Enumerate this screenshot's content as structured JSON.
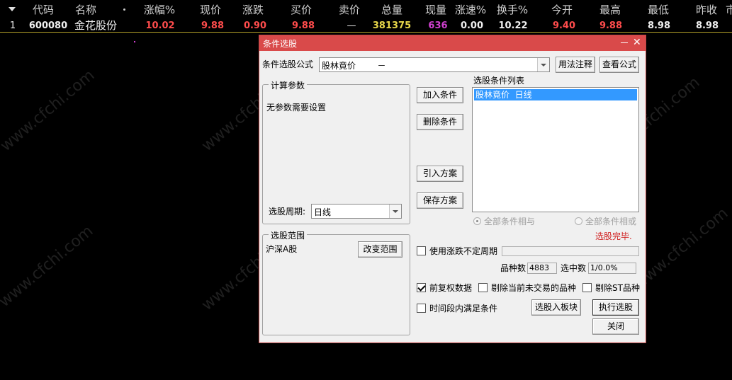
{
  "quote_table": {
    "headers": [
      "代码",
      "名称",
      "涨幅%",
      "现价",
      "涨跌",
      "买价",
      "卖价",
      "总量",
      "现量",
      "涨速%",
      "换手%",
      "今开",
      "最高",
      "最低",
      "昨收",
      "市"
    ],
    "row": {
      "index": "1",
      "code": "600080",
      "name": "金花股份",
      "change_pct": "10.02",
      "price": "9.88",
      "change": "0.90",
      "bid": "9.88",
      "ask": "—",
      "volume": "381375",
      "cur_volume": "636",
      "speed": "0.00",
      "turnover": "10.22",
      "open": "9.40",
      "high": "9.88",
      "low": "8.98",
      "prev_close": "8.98"
    },
    "colors": {
      "up": "#ff4c4c",
      "volume": "#e8d84a",
      "cur_volume": "#d040d0",
      "normal": "#f0f0f0"
    }
  },
  "watermark": "www.cfchi.com",
  "dialog": {
    "title": "条件选股",
    "formula_label": "条件选股公式",
    "formula_value": "股林竟价        －",
    "usage_button": "用法注释",
    "view_formula_button": "查看公式",
    "params_group": "计算参数",
    "no_params": "无参数需要设置",
    "period_label": "选股周期:",
    "period_value": "日线",
    "scope_group": "选股范围",
    "scope_value": "沪深A股",
    "change_scope_button": "改变范围",
    "add_button": "加入条件",
    "delete_button": "删除条件",
    "import_button": "引入方案",
    "save_button": "保存方案",
    "list_label": "选股条件列表",
    "list_items": [
      "股林竟价  日线"
    ],
    "radio_and": "全部条件相与",
    "radio_or": "全部条件相或",
    "status": "选股完毕.",
    "use_period_label": "使用涨跌不定周期",
    "count_label": "品种数",
    "count_value": "4883",
    "selected_label": "选中数",
    "selected_value": "1/0.0%",
    "adj_label": "前复权数据",
    "exclude_untraded_label": "剔除当前未交易的品种",
    "exclude_st_label": "剔除ST品种",
    "time_period_label": "时间段内满足条件",
    "to_block_button": "选股入板块",
    "run_button": "执行选股",
    "close_button": "关闭",
    "accent_color": "#d94a4a"
  }
}
